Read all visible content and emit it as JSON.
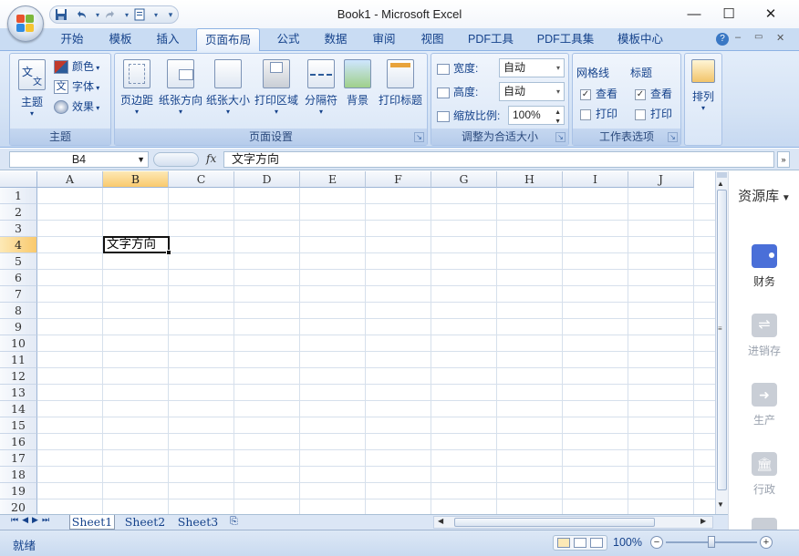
{
  "window": {
    "title": "Book1 - Microsoft Excel",
    "minimize": "—",
    "maximize": "☐",
    "close": "✕"
  },
  "qat": {
    "save_icon": "floppy-icon",
    "undo_icon": "undo-icon",
    "redo_icon": "redo-icon",
    "customize": "▾"
  },
  "tabs": [
    "开始",
    "模板",
    "插入",
    "页面布局",
    "公式",
    "数据",
    "审阅",
    "视图",
    "PDF工具",
    "PDF工具集",
    "模板中心"
  ],
  "active_tab": "页面布局",
  "ribbon": {
    "theme_group": {
      "label": "主题",
      "themes": "主题",
      "colors": "颜色",
      "fonts": "字体",
      "effects": "效果"
    },
    "page_setup_group": {
      "label": "页面设置",
      "margins": "页边距",
      "orientation": "纸张方向",
      "size": "纸张大小",
      "print_area": "打印区域",
      "breaks": "分隔符",
      "background": "背景",
      "print_titles": "打印标题"
    },
    "scale_group": {
      "label": "调整为合适大小",
      "width_label": "宽度:",
      "width_value": "自动",
      "height_label": "高度:",
      "height_value": "自动",
      "scale_label": "缩放比例:",
      "scale_value": "100%"
    },
    "sheet_options_group": {
      "label": "工作表选项",
      "gridlines": "网格线",
      "headings": "标题",
      "view": "查看",
      "print": "打印",
      "view2": "查看",
      "print2": "打印"
    },
    "arrange_group": {
      "label": "排列"
    }
  },
  "formula_bar": {
    "name_box": "B4",
    "fx": "fx",
    "content": "文字方向"
  },
  "grid": {
    "columns": [
      "A",
      "B",
      "C",
      "D",
      "E",
      "F",
      "G",
      "H",
      "I",
      "J"
    ],
    "rows": [
      "1",
      "2",
      "3",
      "4",
      "5",
      "6",
      "7",
      "8",
      "9",
      "10",
      "11",
      "12",
      "13",
      "14",
      "15",
      "16",
      "17",
      "18",
      "19",
      "20"
    ],
    "active_cell_value": "文字方向"
  },
  "sheets": [
    "Sheet1",
    "Sheet2",
    "Sheet3"
  ],
  "active_sheet": "Sheet1",
  "status": {
    "ready": "就绪",
    "zoom": "100%"
  },
  "side_panel": {
    "title": "资源库",
    "items": [
      {
        "label": "财务",
        "icon": "wallet-icon"
      },
      {
        "label": "进销存",
        "icon": "exchange-icon"
      },
      {
        "label": "生产",
        "icon": "arrow-right-icon"
      },
      {
        "label": "行政",
        "icon": "building-icon"
      }
    ]
  }
}
